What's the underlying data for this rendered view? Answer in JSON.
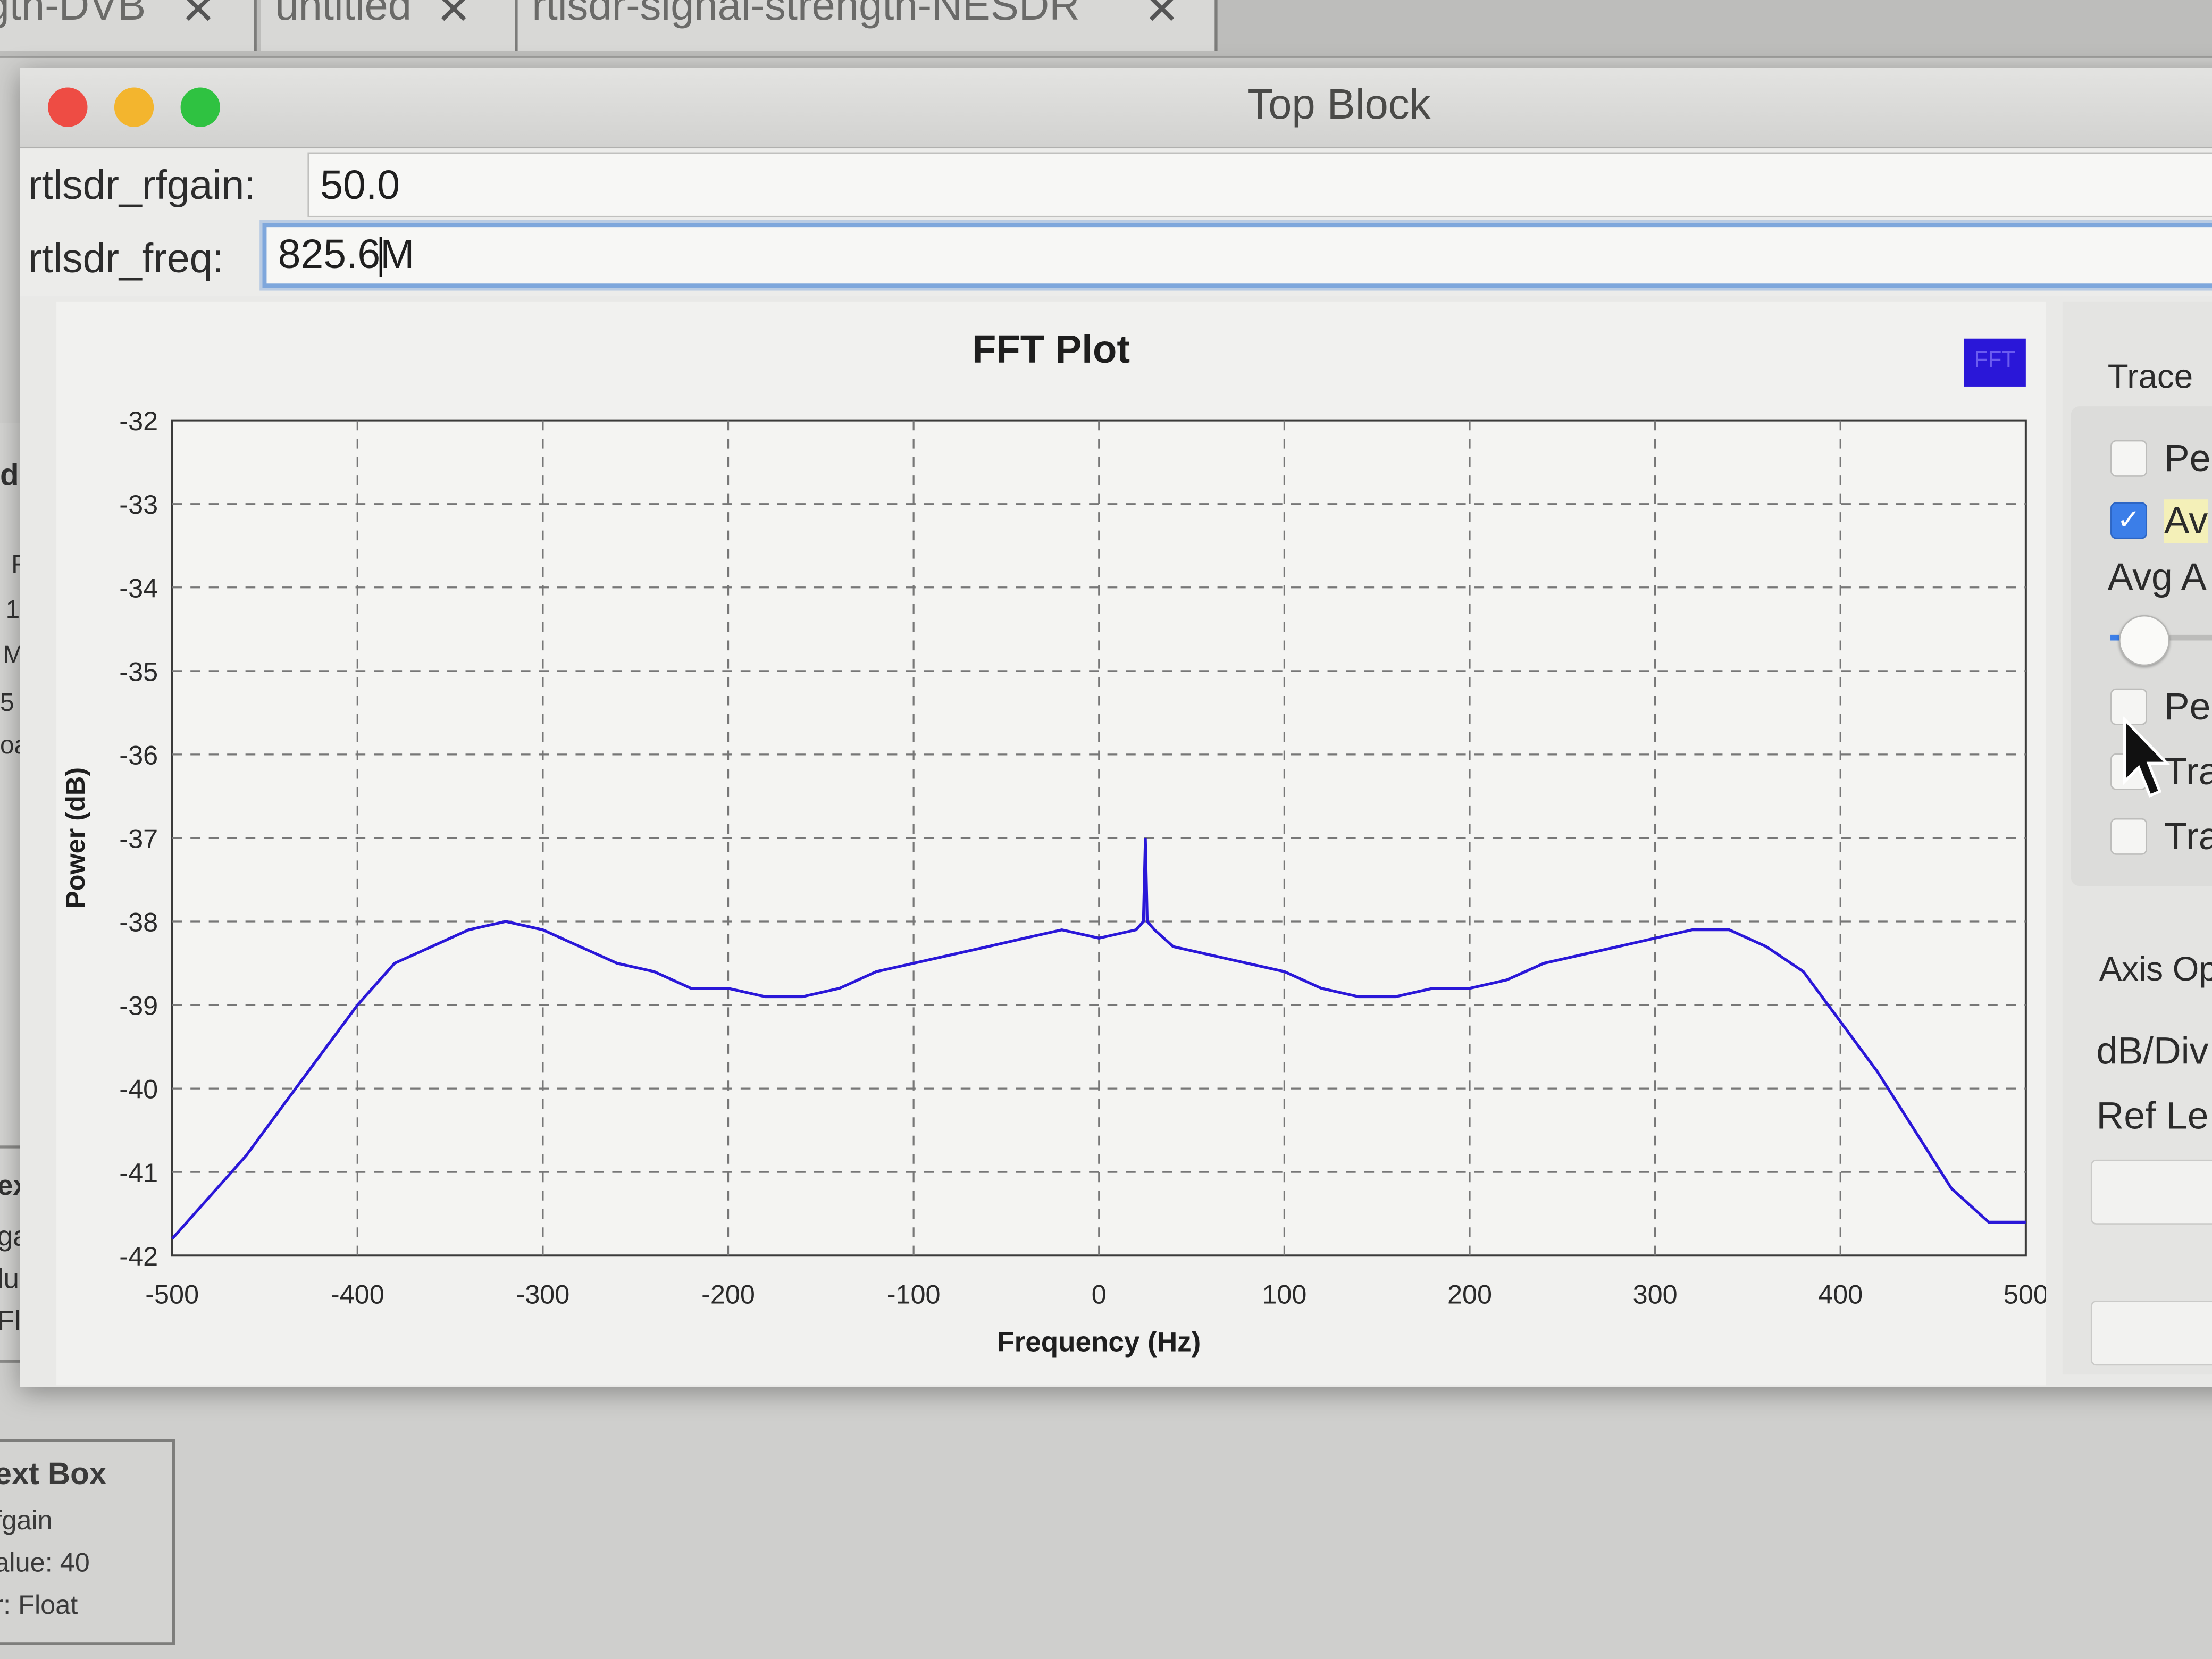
{
  "tabs": [
    {
      "label": "gth-DVB"
    },
    {
      "label": "untitled"
    },
    {
      "label": "rtlsdr-signal-strength-NESDR"
    }
  ],
  "window": {
    "title": "Top Block"
  },
  "params": [
    {
      "label": "rtlsdr_rfgain:",
      "value": "50.0"
    },
    {
      "label": "rtlsdr_freq:",
      "value_before_caret": "825.6",
      "value_after_caret": "M"
    }
  ],
  "background": {
    "left_chars": [
      "d",
      "F",
      "1",
      "M",
      "5",
      "oa"
    ],
    "left_lower": [
      "ext",
      "gai",
      "lue",
      "Flo"
    ],
    "textbox": {
      "title": "ext Box",
      "lines": [
        "fgain",
        "alue: 40",
        "r: Float"
      ]
    }
  },
  "side_panel": {
    "trace_heading": "Trace",
    "options": [
      {
        "label": "Pe",
        "checked": false
      },
      {
        "label": "Av",
        "checked": true
      }
    ],
    "avg_label": "Avg A",
    "slider_level": 0.15,
    "options2": [
      {
        "label": "Pe",
        "checked": false
      },
      {
        "label": "Tra",
        "checked": false
      },
      {
        "label": "Tra",
        "checked": false
      }
    ],
    "axis_heading": "Axis Op",
    "db_div_label": "dB/Div",
    "ref_level_label": "Ref Le"
  },
  "colors": {
    "trace": "#2a17d8",
    "accent": "#3b7ee8"
  },
  "chart_data": {
    "type": "line",
    "title": "FFT Plot",
    "xlabel": "Frequency (Hz)",
    "ylabel": "Power (dB)",
    "legend": [
      "FFT"
    ],
    "legend_placement": "top-right",
    "grid": true,
    "xlim": [
      -500,
      500
    ],
    "ylim": [
      -42,
      -32
    ],
    "xticks": [
      -500,
      -400,
      -300,
      -200,
      -100,
      0,
      100,
      200,
      300,
      400,
      500
    ],
    "yticks": [
      -32,
      -33,
      -34,
      -35,
      -36,
      -37,
      -38,
      -39,
      -40,
      -41,
      -42
    ],
    "series": [
      {
        "name": "FFT",
        "x": [
          -500,
          -480,
          -460,
          -440,
          -420,
          -400,
          -380,
          -360,
          -340,
          -320,
          -300,
          -280,
          -260,
          -240,
          -220,
          -200,
          -180,
          -160,
          -140,
          -120,
          -100,
          -80,
          -60,
          -40,
          -20,
          0,
          20,
          24,
          25,
          26,
          30,
          40,
          60,
          80,
          100,
          120,
          140,
          160,
          180,
          200,
          220,
          240,
          260,
          280,
          300,
          320,
          340,
          360,
          380,
          400,
          420,
          440,
          460,
          480,
          500
        ],
        "y": [
          -41.8,
          -41.3,
          -40.8,
          -40.2,
          -39.6,
          -39.0,
          -38.5,
          -38.3,
          -38.1,
          -38.0,
          -38.1,
          -38.3,
          -38.5,
          -38.6,
          -38.8,
          -38.8,
          -38.9,
          -38.9,
          -38.8,
          -38.6,
          -38.5,
          -38.4,
          -38.3,
          -38.2,
          -38.1,
          -38.2,
          -38.1,
          -38.0,
          -37.0,
          -38.0,
          -38.1,
          -38.3,
          -38.4,
          -38.5,
          -38.6,
          -38.8,
          -38.9,
          -38.9,
          -38.8,
          -38.8,
          -38.7,
          -38.5,
          -38.4,
          -38.3,
          -38.2,
          -38.1,
          -38.1,
          -38.3,
          -38.6,
          -39.2,
          -39.8,
          -40.5,
          -41.2,
          -41.6,
          -41.6
        ]
      }
    ]
  }
}
